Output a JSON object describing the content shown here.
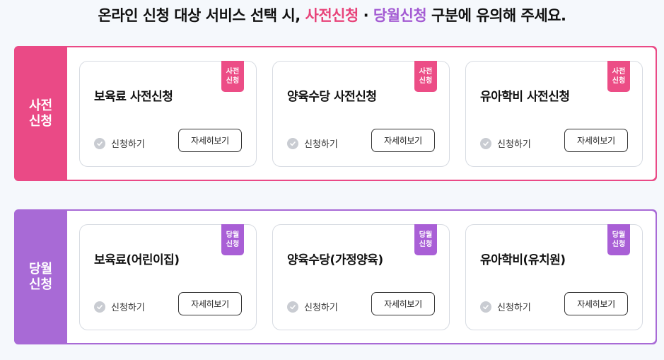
{
  "headline": {
    "prefix": "온라인 신청 대상 서비스 선택 시, ",
    "pre_label": "사전신청",
    "separator": " · ",
    "cur_label": "당월신청",
    "suffix": " 구분에 유의해 주세요."
  },
  "colors": {
    "pre_accent": "#ea4a86",
    "cur_accent": "#a86ad6"
  },
  "sections": [
    {
      "side_label": "사전\n신청",
      "cards": [
        {
          "tag": "사전\n신청",
          "title": "보육료 사전신청",
          "apply_label": "신청하기",
          "detail_label": "자세히보기"
        },
        {
          "tag": "사전\n신청",
          "title": "양육수당 사전신청",
          "apply_label": "신청하기",
          "detail_label": "자세히보기"
        },
        {
          "tag": "사전\n신청",
          "title": "유아학비 사전신청",
          "apply_label": "신청하기",
          "detail_label": "자세히보기"
        }
      ]
    },
    {
      "side_label": "당월\n신청",
      "cards": [
        {
          "tag": "당월\n신청",
          "title": "보육료(어린이집)",
          "apply_label": "신청하기",
          "detail_label": "자세히보기"
        },
        {
          "tag": "당월\n신청",
          "title": "양육수당(가정양육)",
          "apply_label": "신청하기",
          "detail_label": "자세히보기"
        },
        {
          "tag": "당월\n신청",
          "title": "유아학비(유치원)",
          "apply_label": "신청하기",
          "detail_label": "자세히보기"
        }
      ]
    }
  ]
}
